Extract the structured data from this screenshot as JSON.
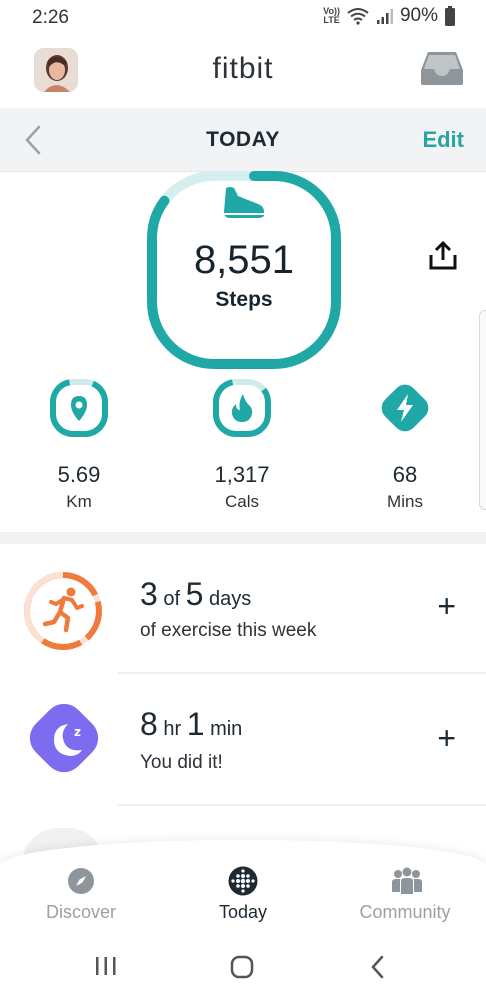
{
  "status_bar": {
    "time": "2:26",
    "battery": "90%",
    "volte_top": "Vo))",
    "volte_bottom": "LTE"
  },
  "header": {
    "app_title": "fitbit"
  },
  "sub_header": {
    "title": "TODAY",
    "edit_label": "Edit"
  },
  "steps": {
    "value": "8,551",
    "label": "Steps"
  },
  "stats": {
    "distance": {
      "value": "5.69",
      "unit": "Km"
    },
    "calories": {
      "value": "1,317",
      "unit": "Cals"
    },
    "active": {
      "value": "68",
      "unit": "Mins"
    }
  },
  "exercise_goal": {
    "count": "3",
    "of_word": "of",
    "target": "5",
    "unit": "days",
    "subtitle": "of exercise this week",
    "add_label": "+"
  },
  "sleep": {
    "hours": "8",
    "hours_unit": "hr",
    "minutes": "1",
    "minutes_unit": "min",
    "subtitle": "You did it!",
    "add_label": "+",
    "badge": "z"
  },
  "bottom_nav": {
    "items": [
      {
        "label": "Discover"
      },
      {
        "label": "Today"
      },
      {
        "label": "Community"
      }
    ]
  },
  "colors": {
    "teal": "#1fa8a6",
    "orange": "#f07a3c",
    "purple": "#7b6cf0"
  }
}
